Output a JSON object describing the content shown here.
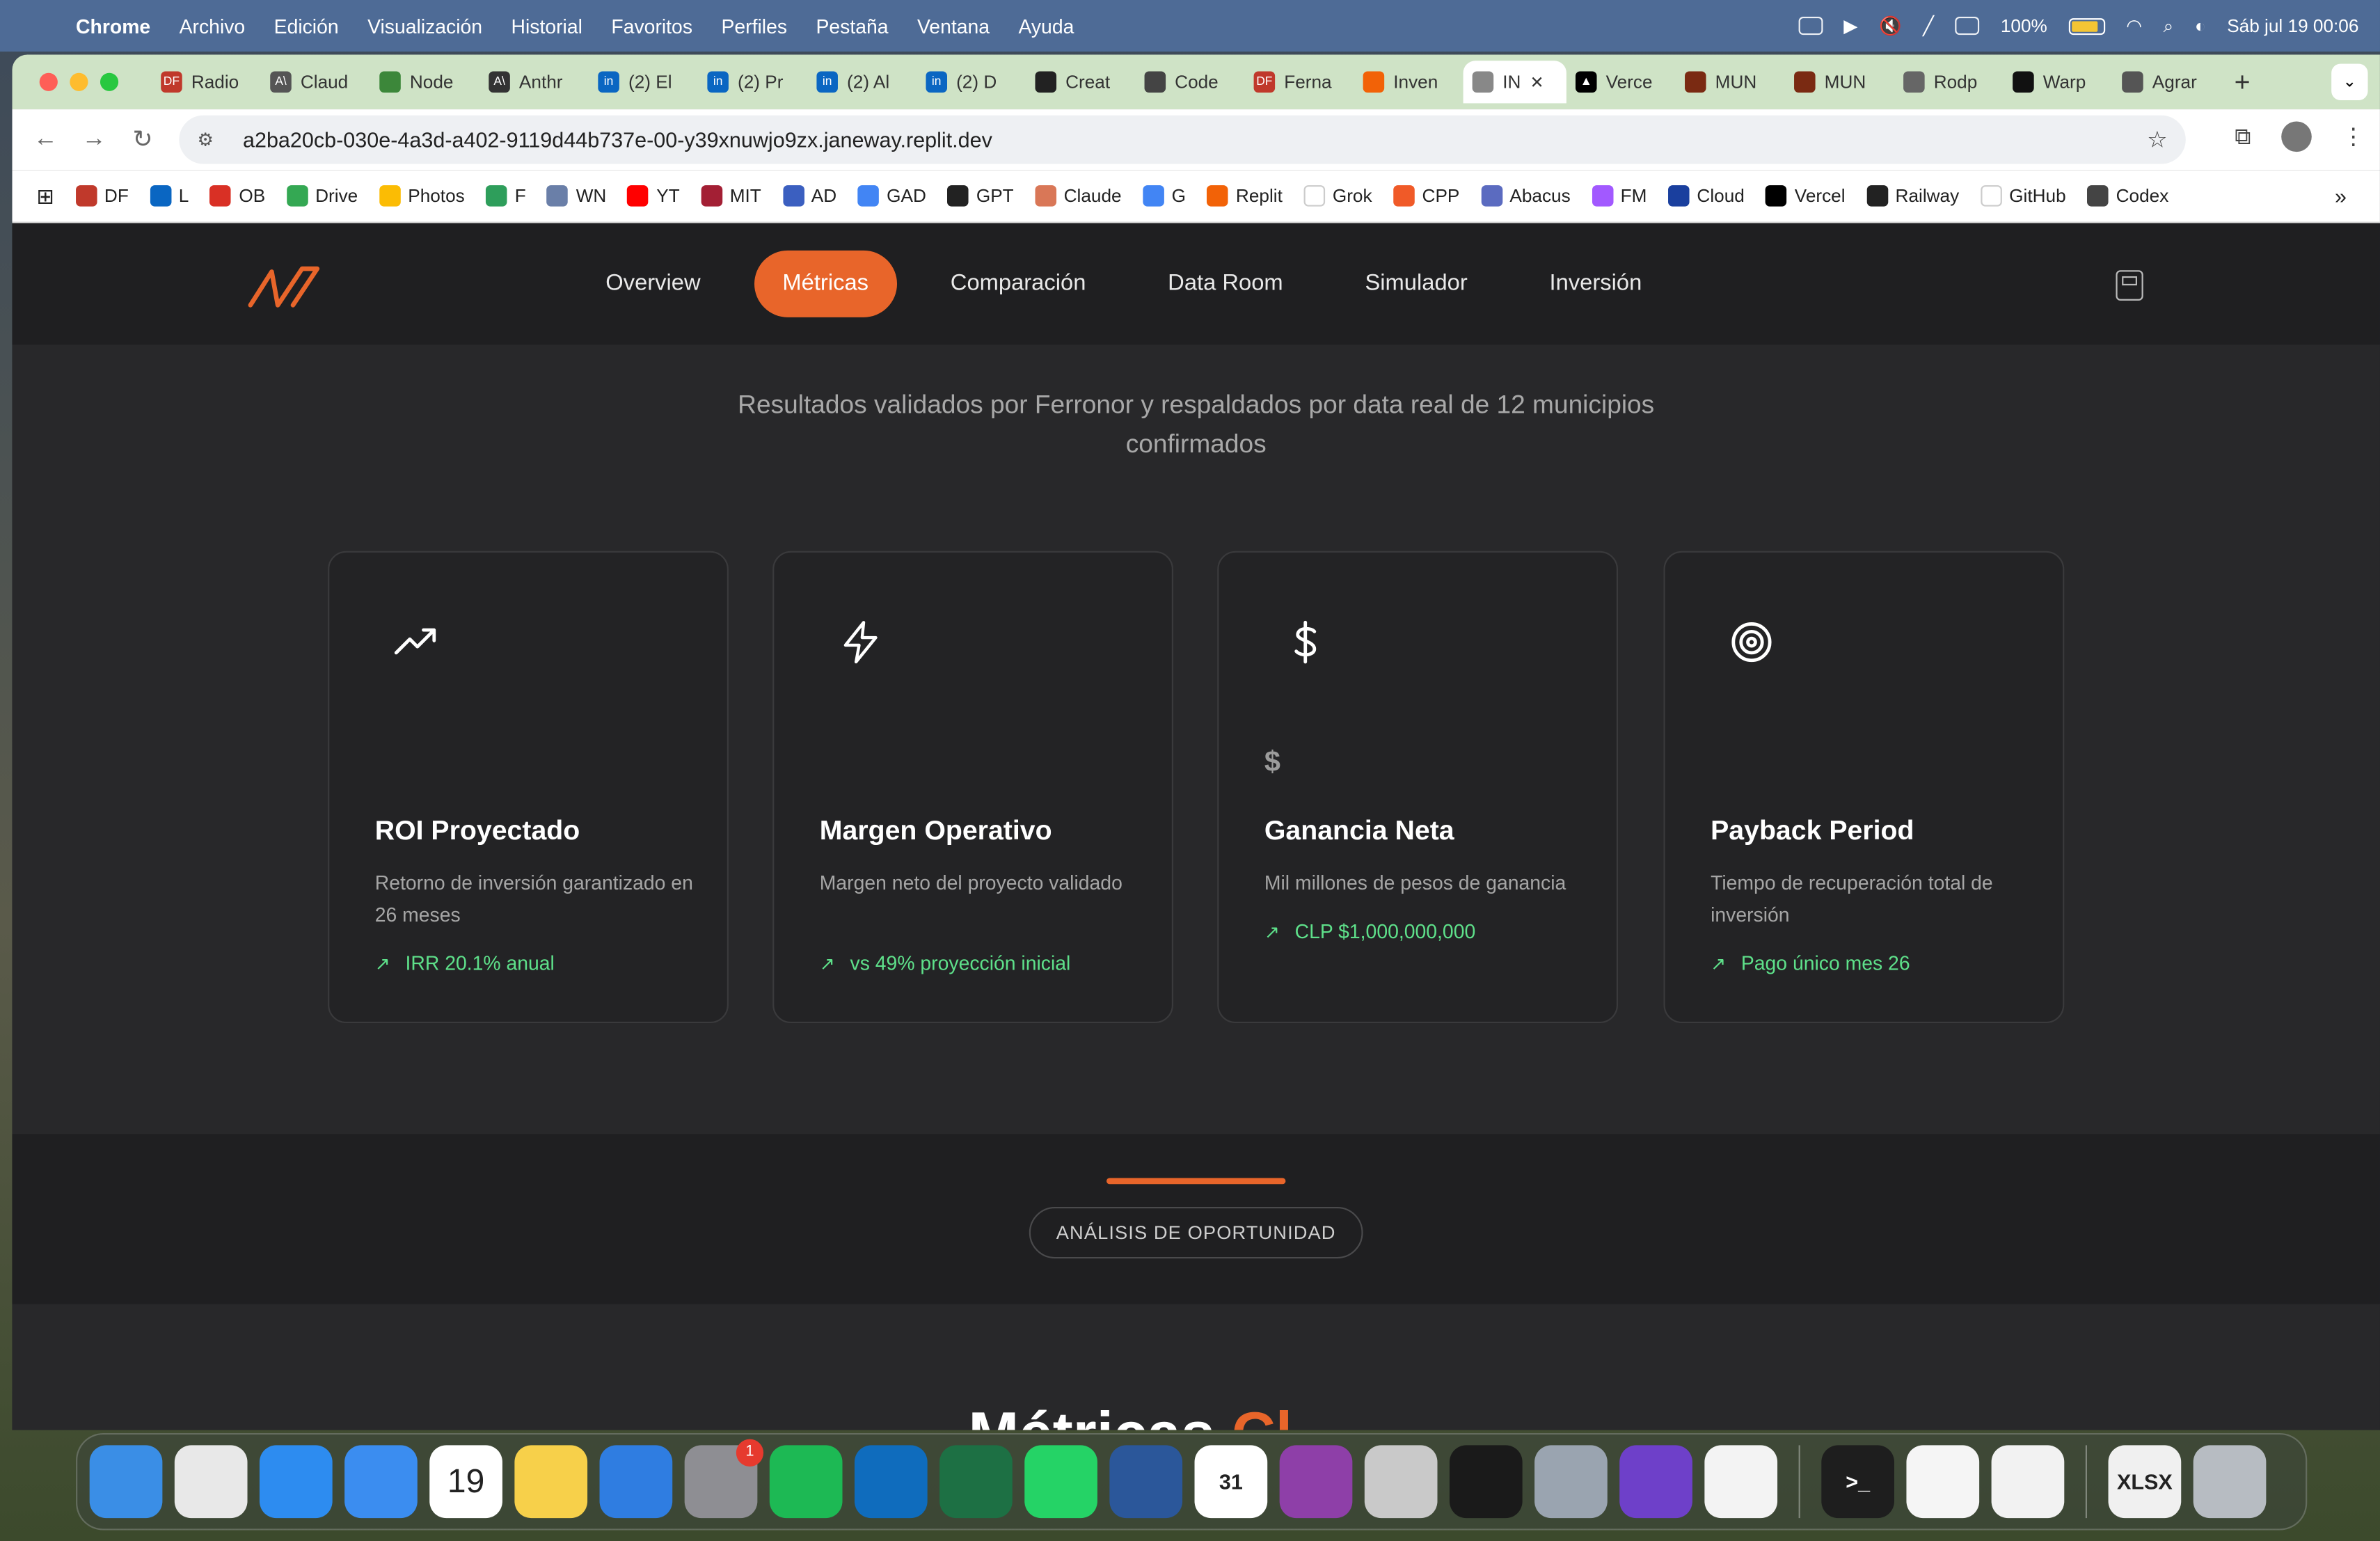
{
  "menubar": {
    "app": "Chrome",
    "items": [
      "Archivo",
      "Edición",
      "Visualización",
      "Historial",
      "Favoritos",
      "Perfiles",
      "Pestaña",
      "Ventana",
      "Ayuda"
    ],
    "battery": "100%",
    "clock": "Sáb jul 19  00:06"
  },
  "tabs": [
    {
      "label": "Radio",
      "color": "#c0392b",
      "icon": "DF"
    },
    {
      "label": "Claud",
      "color": "#555555",
      "icon": "A\\"
    },
    {
      "label": "Node",
      "color": "#3c873a",
      "icon": ""
    },
    {
      "label": "Anthr",
      "color": "#333333",
      "icon": "A\\"
    },
    {
      "label": "(2) El",
      "color": "#0a66c2",
      "icon": "in"
    },
    {
      "label": "(2) Pr",
      "color": "#0a66c2",
      "icon": "in"
    },
    {
      "label": "(2) Al",
      "color": "#0a66c2",
      "icon": "in"
    },
    {
      "label": "(2) D",
      "color": "#0a66c2",
      "icon": "in"
    },
    {
      "label": "Creat",
      "color": "#222222",
      "icon": ""
    },
    {
      "label": "Code",
      "color": "#444444",
      "icon": ""
    },
    {
      "label": "Ferna",
      "color": "#c0392b",
      "icon": "DF"
    },
    {
      "label": "Inven",
      "color": "#f26207",
      "icon": ""
    },
    {
      "label": "IN",
      "color": "#888888",
      "icon": "",
      "active": true
    },
    {
      "label": "Verce",
      "color": "#000000",
      "icon": "▲"
    },
    {
      "label": "MUN",
      "color": "#7a2a12",
      "icon": ""
    },
    {
      "label": "MUN",
      "color": "#7a2a12",
      "icon": ""
    },
    {
      "label": "Rodp",
      "color": "#666666",
      "icon": ""
    },
    {
      "label": "Warp",
      "color": "#111111",
      "icon": ""
    },
    {
      "label": "Agrar",
      "color": "#555555",
      "icon": ""
    }
  ],
  "url": "a2ba20cb-030e-4a3d-a402-9119d44b737e-00-y39xnuwjo9zx.janeway.replit.dev",
  "bookmarks": [
    {
      "label": "DF",
      "color": "#c0392b"
    },
    {
      "label": "L",
      "color": "#0a66c2"
    },
    {
      "label": "OB",
      "color": "#d93025"
    },
    {
      "label": "Drive",
      "color": "#34a853"
    },
    {
      "label": "Photos",
      "color": "#fbbc04"
    },
    {
      "label": "F",
      "color": "#2e9e5b"
    },
    {
      "label": "WN",
      "color": "#6a7fa8"
    },
    {
      "label": "YT",
      "color": "#ff0000"
    },
    {
      "label": "MIT",
      "color": "#a31f34"
    },
    {
      "label": "AD",
      "color": "#3b5fc0"
    },
    {
      "label": "GAD",
      "color": "#4285f4"
    },
    {
      "label": "GPT",
      "color": "#222222"
    },
    {
      "label": "Claude",
      "color": "#d97757"
    },
    {
      "label": "G",
      "color": "#4285f4"
    },
    {
      "label": "Replit",
      "color": "#f26207"
    },
    {
      "label": "Grok",
      "color": "#ffffff"
    },
    {
      "label": "CPP",
      "color": "#f05a28"
    },
    {
      "label": "Abacus",
      "color": "#5b6bc0"
    },
    {
      "label": "FM",
      "color": "#a259ff"
    },
    {
      "label": "Cloud",
      "color": "#1a3f9e"
    },
    {
      "label": "Vercel",
      "color": "#000000"
    },
    {
      "label": "Railway",
      "color": "#222222"
    },
    {
      "label": "GitHub",
      "color": "#ffffff"
    },
    {
      "label": "Codex",
      "color": "#444444"
    }
  ],
  "site": {
    "nav": [
      "Overview",
      "Métricas",
      "Comparación",
      "Data Room",
      "Simulador",
      "Inversión"
    ],
    "subtitle_line1": "Resultados validados por Ferronor y respaldados por data real de 12 municipios",
    "subtitle_line2": "confirmados",
    "cards": [
      {
        "icon": "trending-up-icon",
        "mini": "",
        "title": "ROI Proyectado",
        "desc": "Retorno de inversión garantizado en 26 meses",
        "trend": "IRR 20.1% anual"
      },
      {
        "icon": "zap-icon",
        "mini": "",
        "title": "Margen Operativo",
        "desc": "Margen neto del proyecto validado",
        "trend": "vs 49% proyección inicial"
      },
      {
        "icon": "dollar-icon",
        "mini": "$",
        "title": "Ganancia Neta",
        "desc": "Mil millones de pesos de ganancia",
        "trend": "CLP $1,000,000,000"
      },
      {
        "icon": "target-icon",
        "mini": "",
        "title": "Payback Period",
        "desc": "Tiempo de recuperación total de inversión",
        "trend": "Pago único mes 26"
      }
    ],
    "section_pill": "ANÁLISIS DE OPORTUNIDAD",
    "partial_heading_a": "Métricas",
    "partial_heading_b": "Cl",
    "accent": "#e8652a",
    "trend_color": "#5ee08a"
  },
  "dock": [
    {
      "name": "finder",
      "color": "#3a8ee6",
      "label": ""
    },
    {
      "name": "chrome",
      "color": "#e8e8e8",
      "label": ""
    },
    {
      "name": "safari",
      "color": "#2d8cf0",
      "label": ""
    },
    {
      "name": "mail",
      "color": "#3b8df0",
      "label": ""
    },
    {
      "name": "calendar",
      "color": "#ffffff",
      "label": "19"
    },
    {
      "name": "notes",
      "color": "#f7d04a",
      "label": ""
    },
    {
      "name": "keynote",
      "color": "#2f7de1",
      "label": ""
    },
    {
      "name": "system-settings",
      "color": "#8e8e93",
      "label": "",
      "badge": "1"
    },
    {
      "name": "spotify",
      "color": "#1db954",
      "label": ""
    },
    {
      "name": "outlook",
      "color": "#0f6cbd",
      "label": ""
    },
    {
      "name": "excel",
      "color": "#1d7044",
      "label": ""
    },
    {
      "name": "whatsapp",
      "color": "#25d366",
      "label": ""
    },
    {
      "name": "word",
      "color": "#2b579a",
      "label": ""
    },
    {
      "name": "calendar-31",
      "color": "#ffffff",
      "label": "31"
    },
    {
      "name": "circle-app",
      "color": "#8e3fa8",
      "label": ""
    },
    {
      "name": "iphone-mirroring",
      "color": "#c9c9c9",
      "label": ""
    },
    {
      "name": "replit",
      "color": "#1a1a1a",
      "label": ""
    },
    {
      "name": "screen-app",
      "color": "#9aa4b0",
      "label": ""
    },
    {
      "name": "github-desktop",
      "color": "#6e40c9",
      "label": ""
    },
    {
      "name": "vscode",
      "color": "#f3f3f3",
      "label": ""
    },
    {
      "name": "terminal",
      "color": "#1e1e1e",
      "label": ">_"
    },
    {
      "name": "textedit",
      "color": "#f5f5f5",
      "label": ""
    },
    {
      "name": "passwords",
      "color": "#f2f2f2",
      "label": ""
    },
    {
      "name": "xlsx-file",
      "color": "#f0f0f0",
      "label": "XLSX"
    },
    {
      "name": "trash",
      "color": "#b7bcc2",
      "label": ""
    }
  ]
}
